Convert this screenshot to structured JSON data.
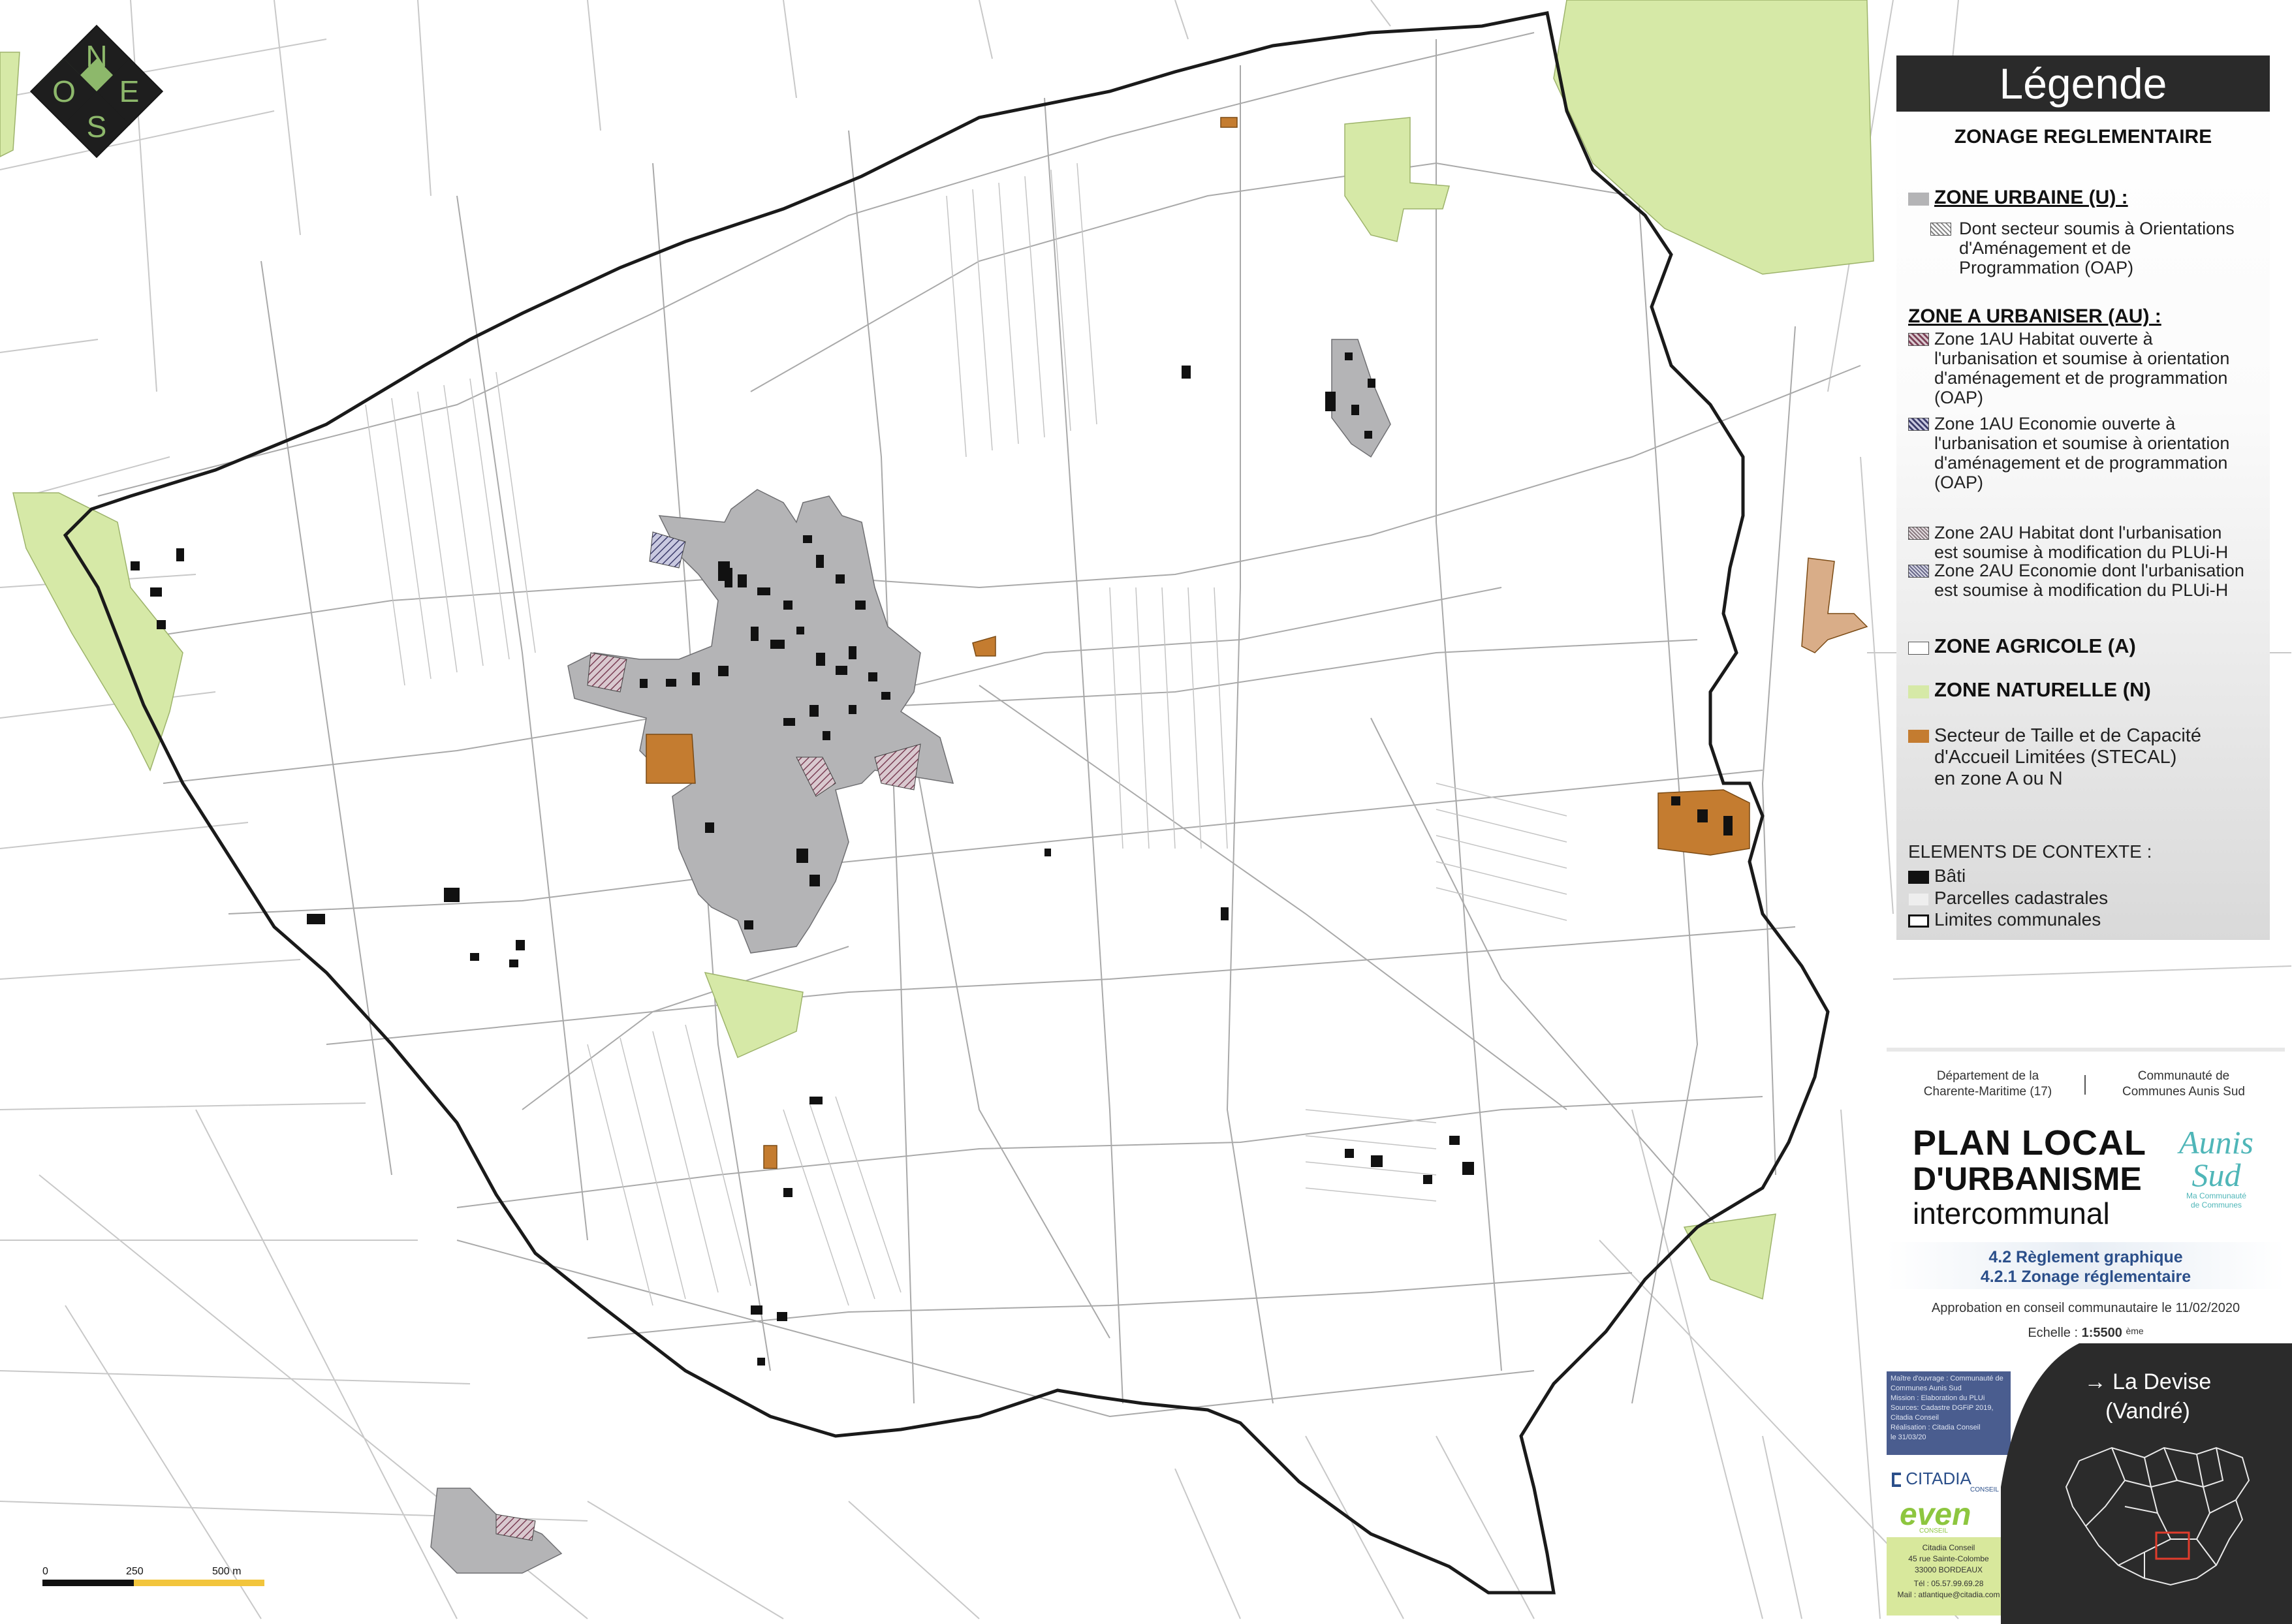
{
  "compass": {
    "n": "N",
    "o": "O",
    "e": "E",
    "s": "S"
  },
  "legend": {
    "title": "Légende",
    "subtitle": "ZONAGE REGLEMENTAIRE",
    "zone_u": {
      "title": "ZONE URBAINE (U) :",
      "oap": "Dont secteur soumis à Orientations d'Aménagement et de Programmation (OAP)",
      "oap_lines": [
        "Dont secteur soumis à Orientations",
        "d'Aménagement et de",
        "Programmation (OAP)"
      ]
    },
    "zone_au": {
      "title": "ZONE A URBANISER (AU) :",
      "au1_habitat_lines": [
        "Zone 1AU Habitat ouverte à",
        "l'urbanisation et soumise à orientation",
        "d'aménagement et de programmation",
        "(OAP)"
      ],
      "au1_economie_lines": [
        "Zone 1AU Economie ouverte à",
        "l'urbanisation et soumise à orientation",
        "d'aménagement et de programmation",
        "(OAP)"
      ],
      "au2_habitat_lines": [
        "Zone 2AU Habitat dont l'urbanisation",
        "est soumise à modification du PLUi-H"
      ],
      "au2_economie_lines": [
        "Zone 2AU Economie dont l'urbanisation",
        "est soumise à modification du PLUi-H"
      ]
    },
    "zone_a": "ZONE AGRICOLE (A)",
    "zone_n": "ZONE NATURELLE (N)",
    "stecal_lines": [
      "Secteur de Taille et de Capacité",
      "d'Accueil Limitées (STECAL)",
      "en zone A ou N"
    ],
    "context_title": "ELEMENTS DE CONTEXTE :",
    "context": {
      "bati": "Bâti",
      "parcelles": "Parcelles cadastrales",
      "limites": "Limites communales"
    }
  },
  "cartouche": {
    "departement_lines": [
      "Département de la",
      "Charente-Maritime (17)"
    ],
    "communaute_lines": [
      "Communauté de",
      "Communes Aunis Sud"
    ],
    "plan_lines": [
      "PLAN LOCAL",
      "D'URBANISME",
      "intercommunal"
    ],
    "logo_text_lines": [
      "Aunis",
      "Sud"
    ],
    "logo_tag_lines": [
      "Ma Communauté",
      "de Communes"
    ],
    "reglement_lines": [
      "4.2 Règlement graphique",
      "4.2.1 Zonage réglementaire"
    ],
    "approbation": "Approbation en conseil communautaire le 11/02/2020",
    "echelle_label": "Echelle :",
    "echelle_value": "1:5500",
    "echelle_suffix": "ème",
    "credits_lines": [
      "Maître d'ouvrage : Communauté de",
      "Communes Aunis Sud",
      "Mission : Elaboration du PLUi",
      "Sources: Cadastre DGFiP 2019,",
      "Citadia Conseil",
      "Réalisation : Citadia Conseil",
      "le 31/03/20"
    ],
    "citadia": "CITADIA",
    "citadia_sub": "CONSEIL",
    "even": "even",
    "even_sub": "CONSEIL",
    "address_lines": [
      "Citadia Conseil",
      "45 rue Sainte-Colombe",
      "33000 BORDEAUX",
      "Tél : 05.57.99.69.28",
      "Mail : atlantique@citadia.com"
    ],
    "commune_lines": [
      "→ La Devise",
      "(Vandré)"
    ]
  },
  "scalebar": {
    "labels": [
      "0",
      "250",
      "500 m"
    ]
  },
  "colors": {
    "urbain": "#b4b4b6",
    "naturelle": "#d6e9a7",
    "stecal": "#c47c30",
    "bati": "#111111",
    "limite": "#1a1a1a",
    "parcel": "#a9a9a9",
    "legend_header": "#2a2a2a",
    "accent_blue": "#2b4f8a",
    "inset_bg": "#2b2b2b"
  }
}
